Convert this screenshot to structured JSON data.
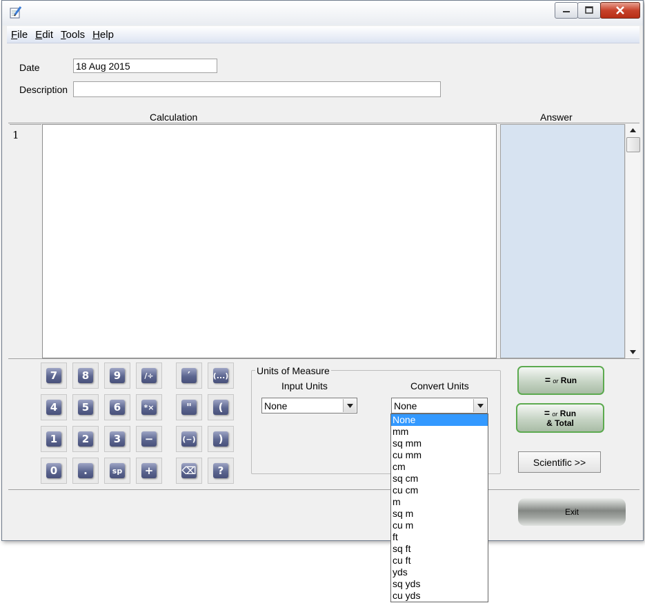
{
  "window": {
    "title": ""
  },
  "menu": [
    {
      "id": "file",
      "accel": "F",
      "rest": "ile"
    },
    {
      "id": "edit",
      "accel": "E",
      "rest": "dit"
    },
    {
      "id": "tools",
      "accel": "T",
      "rest": "ools"
    },
    {
      "id": "help",
      "accel": "H",
      "rest": "elp"
    }
  ],
  "form": {
    "date_label": "Date",
    "date_value": "18 Aug 2015",
    "description_label": "Description",
    "description_value": ""
  },
  "columns": {
    "calculation": "Calculation",
    "answer": "Answer"
  },
  "editor": {
    "line_numbers": [
      "1"
    ],
    "calculation_text": "",
    "answer_text": ""
  },
  "keypad": {
    "numeric": [
      [
        "7",
        "8",
        "9",
        "/÷"
      ],
      [
        "4",
        "5",
        "6",
        "*×"
      ],
      [
        "1",
        "2",
        "3",
        "−"
      ],
      [
        "0",
        ".",
        "sp",
        "+"
      ]
    ],
    "special": [
      [
        "′",
        "(...)"
      ],
      [
        "\"",
        "("
      ],
      [
        "(−)",
        ")"
      ],
      [
        "⌫",
        "?"
      ]
    ]
  },
  "units": {
    "group_title": "Units of Measure",
    "input_label": "Input Units",
    "convert_label": "Convert Units",
    "input_value": "None",
    "convert_value": "None",
    "options": [
      "None",
      "mm",
      "sq mm",
      "cu mm",
      "cm",
      "sq cm",
      "cu cm",
      "m",
      "sq m",
      "cu m",
      "ft",
      "sq ft",
      "cu ft",
      "yds",
      "sq yds",
      "cu yds"
    ],
    "selected_option": "None"
  },
  "buttons": {
    "run": {
      "symbol": "=",
      "or": "or",
      "label": "Run"
    },
    "run_total": {
      "symbol": "=",
      "or": "or",
      "label": "Run",
      "label2": "& Total"
    },
    "scientific": "Scientific >>",
    "exit": "Exit"
  },
  "colors": {
    "answer_bg": "#d7e3f1",
    "selection": "#3399ff",
    "run_border": "#5caa4f",
    "key_face": "#5c6690"
  },
  "icons": {
    "app": "notepad-pencil-icon",
    "minimize": "minimize-icon",
    "maximize": "maximize-icon",
    "close": "close-icon",
    "scroll_up": "scroll-up-arrow-icon",
    "scroll_down": "scroll-down-arrow-icon",
    "dropdown": "chevron-down-icon",
    "backspace": "backspace-icon"
  }
}
